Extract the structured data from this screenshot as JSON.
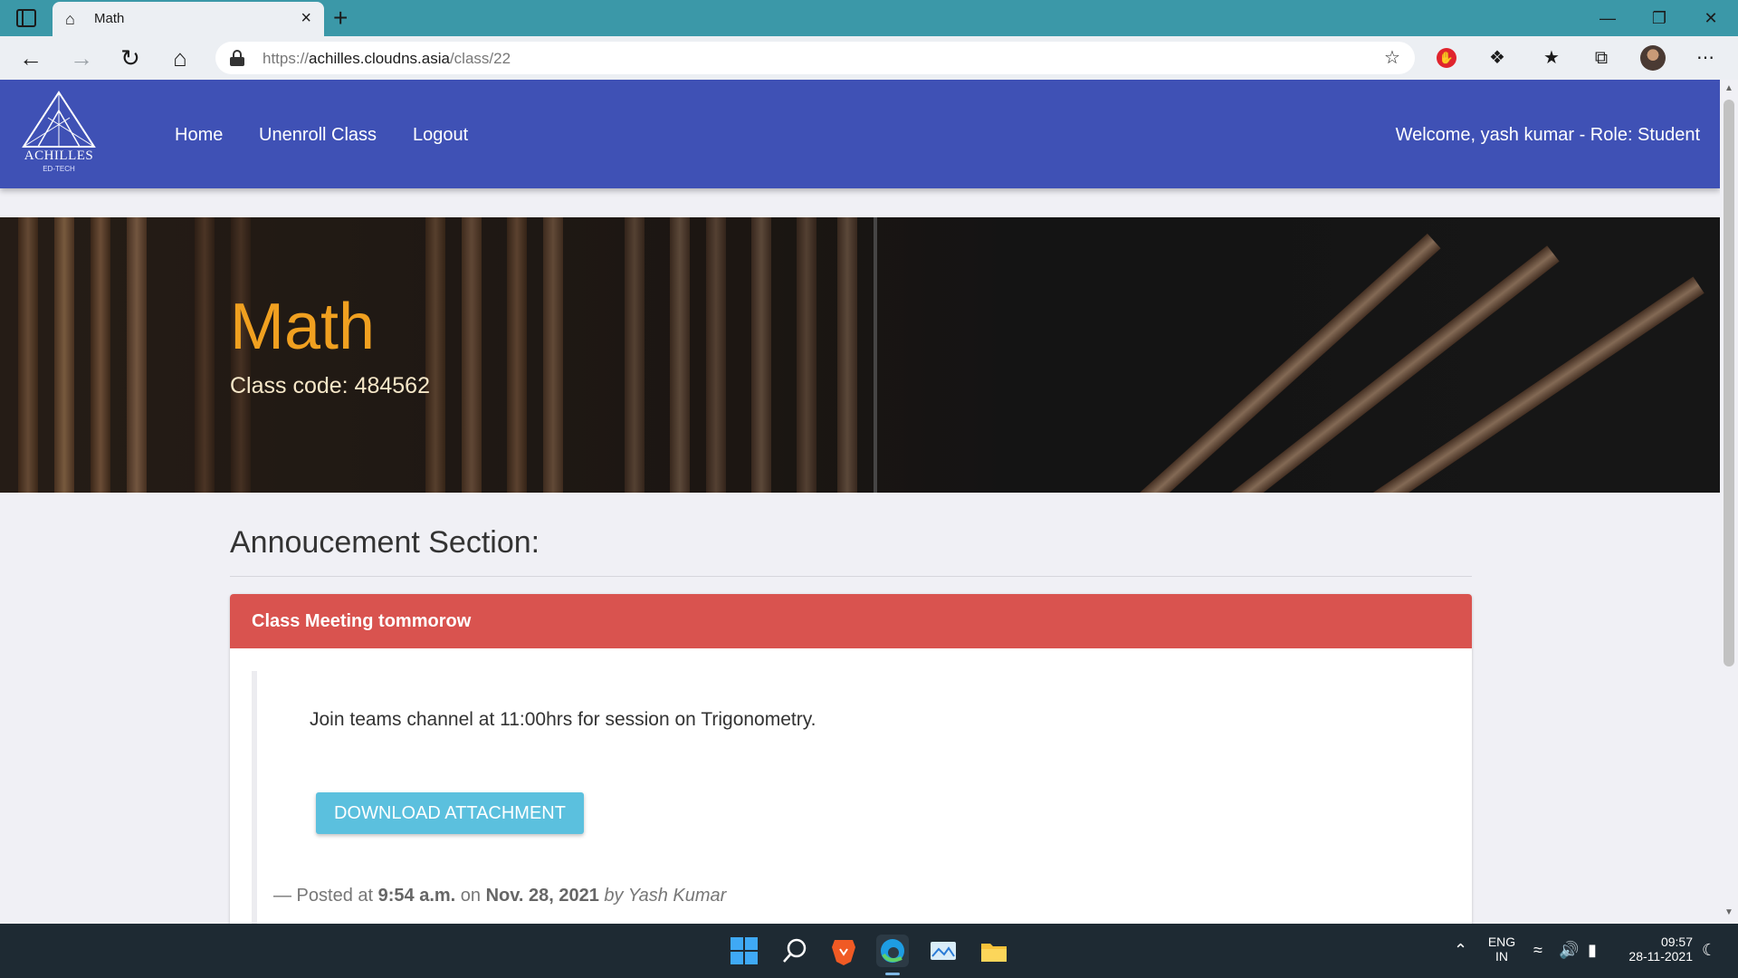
{
  "browser": {
    "tab_title": "Math",
    "new_tab": "+",
    "url_scheme": "https://",
    "url_host": "achilles.cloudns.asia",
    "url_path": "/class/22",
    "window_controls": [
      "minimize",
      "restore",
      "close"
    ],
    "toolbar_icons": [
      "add-favorite-icon",
      "adblock-extension-icon",
      "extensions-icon",
      "favorites-icon",
      "collections-icon",
      "profile-avatar",
      "more-icon"
    ]
  },
  "navbar": {
    "logo_text": "ACHILLES",
    "logo_sub": "ED-TECH",
    "links": [
      "Home",
      "Unenroll Class",
      "Logout"
    ],
    "welcome": "Welcome, yash kumar - Role: Student"
  },
  "hero": {
    "title": "Math",
    "class_code": "Class code: 484562"
  },
  "announcements": {
    "section_title": "Annoucement Section:",
    "items": [
      {
        "title": "Class Meeting tommorow",
        "body": "Join teams channel at 11:00hrs for session on Trigonometry.",
        "button_label": "DOWNLOAD ATTACHMENT",
        "posted_prefix": "— Posted at ",
        "posted_time": "9:54 a.m.",
        "posted_on": " on ",
        "posted_date": "Nov. 28, 2021",
        "posted_by": " by Yash Kumar"
      }
    ]
  },
  "taskbar": {
    "apps": [
      "start-icon",
      "search-icon",
      "brave-browser-icon",
      "edge-browser-icon",
      "photos-app-icon",
      "file-explorer-icon"
    ],
    "language_line1": "ENG",
    "language_line2": "IN",
    "time": "09:57",
    "date": "28-11-2021"
  },
  "colors": {
    "navbar": "#3f51b5",
    "hero_title": "#f0a020",
    "card_header": "#d9534f",
    "button": "#5bc0de",
    "tabbar": "#3b98a8"
  }
}
